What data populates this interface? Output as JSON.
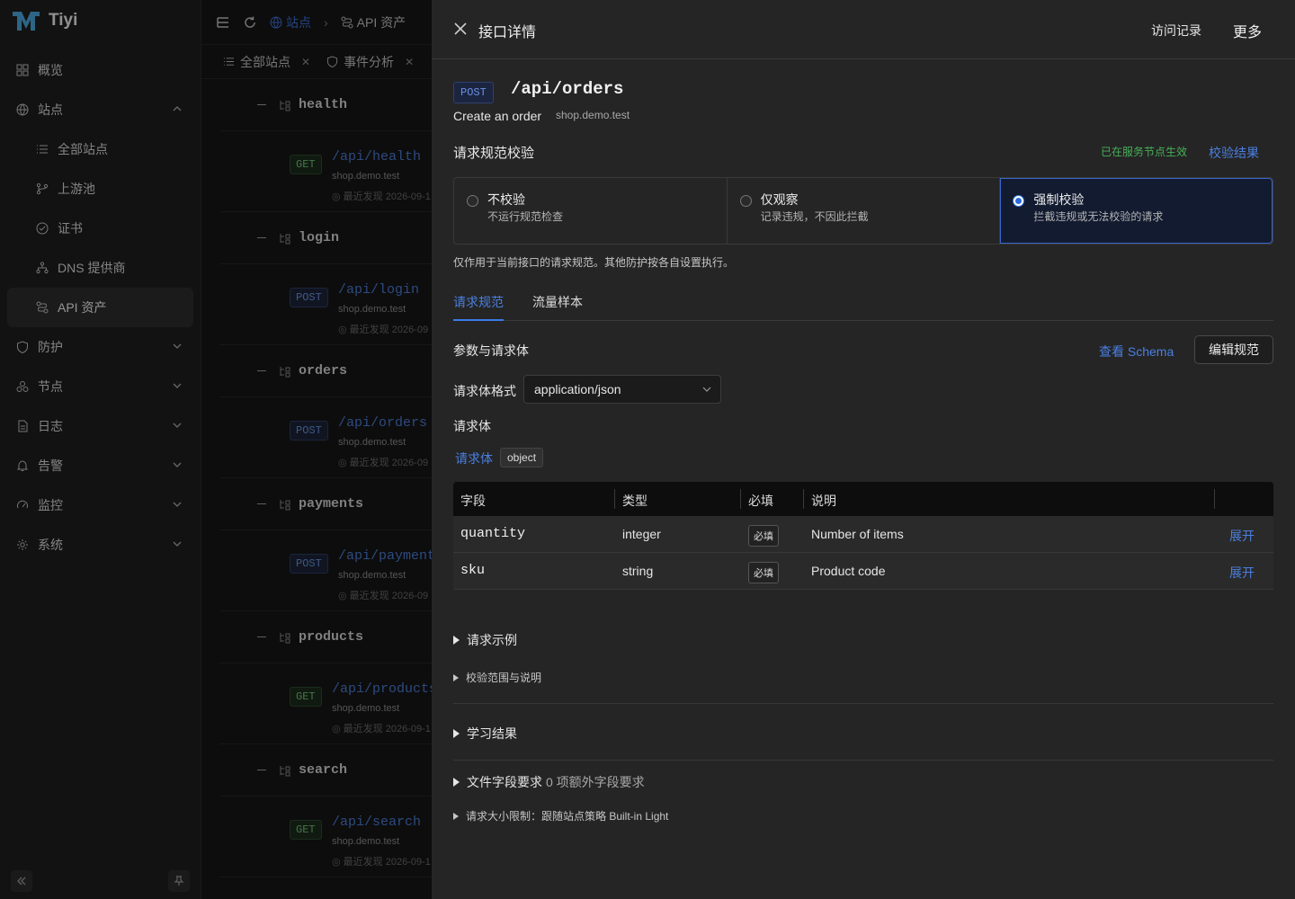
{
  "app": {
    "name": "Tiyi"
  },
  "sidebar": {
    "items": [
      {
        "label": "概览",
        "icon": "dashboard-icon",
        "sub": false,
        "active": false,
        "chevron": ""
      },
      {
        "label": "站点",
        "icon": "globe-icon",
        "sub": false,
        "active": false,
        "chevron": "up"
      },
      {
        "label": "全部站点",
        "icon": "list-icon",
        "sub": true,
        "active": false,
        "chevron": ""
      },
      {
        "label": "上游池",
        "icon": "branch-icon",
        "sub": true,
        "active": false,
        "chevron": ""
      },
      {
        "label": "证书",
        "icon": "certificate-icon",
        "sub": true,
        "active": false,
        "chevron": ""
      },
      {
        "label": "DNS 提供商",
        "icon": "network-icon",
        "sub": true,
        "active": false,
        "chevron": ""
      },
      {
        "label": "API 资产",
        "icon": "api-icon",
        "sub": true,
        "active": true,
        "chevron": ""
      },
      {
        "label": "防护",
        "icon": "shield-icon",
        "sub": false,
        "active": false,
        "chevron": "down"
      },
      {
        "label": "节点",
        "icon": "nodes-icon",
        "sub": false,
        "active": false,
        "chevron": "down"
      },
      {
        "label": "日志",
        "icon": "log-icon",
        "sub": false,
        "active": false,
        "chevron": "down"
      },
      {
        "label": "告警",
        "icon": "bell-icon",
        "sub": false,
        "active": false,
        "chevron": "down"
      },
      {
        "label": "监控",
        "icon": "gauge-icon",
        "sub": false,
        "active": false,
        "chevron": "down"
      },
      {
        "label": "系统",
        "icon": "gear-icon",
        "sub": false,
        "active": false,
        "chevron": "down"
      }
    ]
  },
  "topbar": {
    "crumb_sites": "站点",
    "crumb_api": "API 资产"
  },
  "tabs": [
    {
      "label": "全部站点",
      "icon": "list-icon"
    },
    {
      "label": "事件分析",
      "icon": "shield-icon"
    }
  ],
  "api_groups": [
    {
      "name": "health",
      "method": "GET",
      "path": "/api/health",
      "host": "shop.demo.test",
      "seen": "最近发现 2026-09-1"
    },
    {
      "name": "login",
      "method": "POST",
      "path": "/api/login",
      "host": "shop.demo.test",
      "seen": "最近发现 2026-09"
    },
    {
      "name": "orders",
      "method": "POST",
      "path": "/api/orders",
      "host": "shop.demo.test",
      "seen": "最近发现 2026-09"
    },
    {
      "name": "payments",
      "method": "POST",
      "path": "/api/payments",
      "host": "shop.demo.test",
      "seen": "最近发现 2026-09"
    },
    {
      "name": "products",
      "method": "GET",
      "path": "/api/products",
      "host": "shop.demo.test",
      "seen": "最近发现 2026-09-1"
    },
    {
      "name": "search",
      "method": "GET",
      "path": "/api/search",
      "host": "shop.demo.test",
      "seen": "最近发现 2026-09-1"
    }
  ],
  "drawer": {
    "title": "接口详情",
    "visit_log": "访问记录",
    "more": "更多",
    "method": "POST",
    "path": "/api/orders",
    "description": "Create an order",
    "host": "shop.demo.test",
    "validation": {
      "title": "请求规范校验",
      "status": "已在服务节点生效",
      "result_link": "校验结果",
      "modes": [
        {
          "title": "不校验",
          "desc": "不运行规范检查",
          "selected": false
        },
        {
          "title": "仅观察",
          "desc": "记录违规，不因此拦截",
          "selected": false
        },
        {
          "title": "强制校验",
          "desc": "拦截违规或无法校验的请求",
          "selected": true
        }
      ],
      "note": "仅作用于当前接口的请求规范。其他防护按各自设置执行。"
    },
    "detail_tabs": [
      "请求规范",
      "流量样本"
    ],
    "params": {
      "title": "参数与请求体",
      "schema_link": "查看 Schema",
      "edit_button": "编辑规范",
      "format_label": "请求体格式",
      "format_value": "application/json",
      "body_title": "请求体",
      "body_link": "请求体",
      "body_type": "object"
    },
    "table": {
      "headers": [
        "字段",
        "类型",
        "必填",
        "说明"
      ],
      "rows": [
        {
          "field": "quantity",
          "type": "integer",
          "required": "必填",
          "desc": "Number of items",
          "action": "展开"
        },
        {
          "field": "sku",
          "type": "string",
          "required": "必填",
          "desc": "Product code",
          "action": "展开"
        }
      ]
    },
    "sections": {
      "request_example": "请求示例",
      "scope": "校验范围与说明",
      "learning": "学习结果",
      "file_fields": "文件字段要求",
      "file_fields_count": "0 项额外字段要求",
      "size_limit": "请求大小限制：跟随站点策略 Built-in Light"
    }
  },
  "colors": {
    "accent": "#3a7be8",
    "success": "#46b058",
    "background": "#141414",
    "drawer": "#252525"
  }
}
